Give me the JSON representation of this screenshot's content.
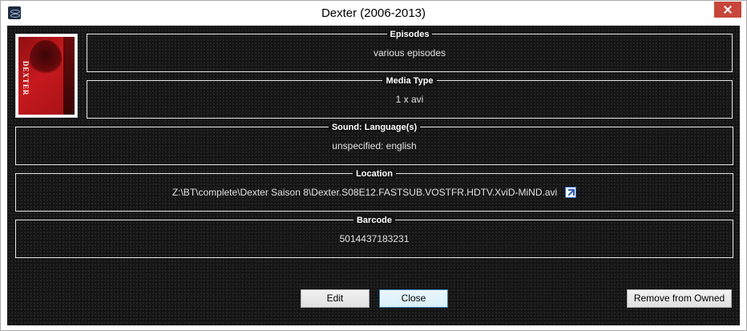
{
  "window": {
    "title": "Dexter (2006-2013)"
  },
  "cover": {
    "logo_text": "DEXTER"
  },
  "episodes": {
    "label": "Episodes",
    "value": "various episodes"
  },
  "media_type": {
    "label": "Media Type",
    "value": "1 x avi"
  },
  "sound": {
    "label": "Sound: Language(s)",
    "value": "unspecified: english"
  },
  "location": {
    "label": "Location",
    "value": "Z:\\BT\\complete\\Dexter Saison 8\\Dexter.S08E12.FASTSUB.VOSTFR.HDTV.XviD-MiND.avi"
  },
  "barcode": {
    "label": "Barcode",
    "value": "5014437183231"
  },
  "buttons": {
    "edit": "Edit",
    "close": "Close",
    "remove": "Remove from Owned"
  },
  "icons": {
    "app": "app-icon",
    "close": "close-icon",
    "link": "external-link-icon"
  },
  "colors": {
    "background": "#141414",
    "frame_border": "#e6e6e6",
    "close_button": "#c7463a"
  }
}
